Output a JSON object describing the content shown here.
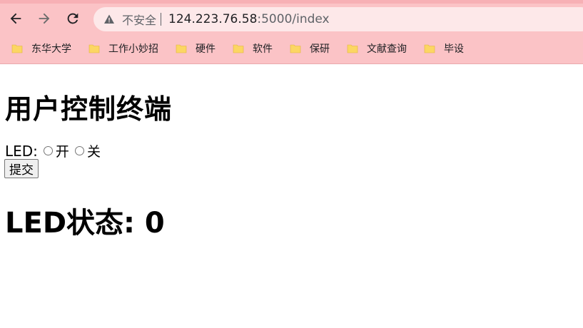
{
  "browser": {
    "security_label": "不安全",
    "url_host": "124.223.76.58",
    "url_rest": ":5000/index",
    "icons": {
      "back": "arrow-left-icon",
      "forward": "arrow-right-icon",
      "reload": "reload-icon",
      "security": "warning-triangle-icon",
      "bookmark": "folder-icon"
    },
    "colors": {
      "chrome": "#fbc3c6",
      "omnibox": "#fde8e9",
      "folder": "#fcd663"
    }
  },
  "bookmarks": [
    {
      "label": "东华大学"
    },
    {
      "label": "工作小妙招"
    },
    {
      "label": "硬件"
    },
    {
      "label": "软件"
    },
    {
      "label": "保研"
    },
    {
      "label": "文献查询"
    },
    {
      "label": "毕设"
    }
  ],
  "page": {
    "title": "用户控制终端",
    "led_label": "LED:",
    "options": [
      {
        "label": "开",
        "selected": false
      },
      {
        "label": "关",
        "selected": false
      }
    ],
    "submit_label": "提交",
    "status_text": "LED状态: 0"
  }
}
